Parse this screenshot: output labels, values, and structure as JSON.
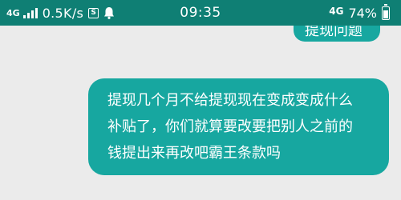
{
  "status_bar": {
    "network_left": "4G",
    "speed": "0.5K/s",
    "data_icon_glyph": "S",
    "time": "09:35",
    "network_right": "4G",
    "battery": "74%",
    "battery_level": 0.74,
    "background_color": "#0f7f74",
    "icons": [
      "signal-icon",
      "data-saver-icon",
      "notification-bell-icon",
      "battery-icon"
    ]
  },
  "chat": {
    "bubble_color": "#17a7a0",
    "background_color": "#ebebeb",
    "messages": [
      {
        "text": "提现问题"
      },
      {
        "lines": [
          "提现几个月不给提现现在变成变成什么",
          "补贴了，你们就算要改要把别人之前的",
          "钱提出来再改吧霸王条款吗"
        ]
      }
    ]
  }
}
